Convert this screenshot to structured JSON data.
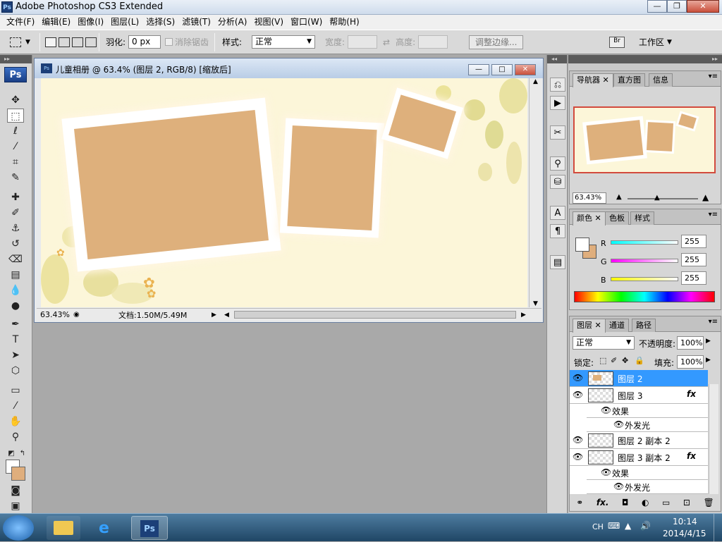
{
  "app": {
    "title": "Adobe Photoshop CS3 Extended"
  },
  "menu": [
    "文件(F)",
    "编辑(E)",
    "图像(I)",
    "图层(L)",
    "选择(S)",
    "滤镜(T)",
    "分析(A)",
    "视图(V)",
    "窗口(W)",
    "帮助(H)"
  ],
  "options": {
    "feather_label": "羽化:",
    "feather_value": "0 px",
    "antialias_label": "消除锯齿",
    "style_label": "样式:",
    "style_value": "正常",
    "width_label": "宽度:",
    "height_label": "高度:",
    "refine_button": "调整边缘...",
    "workspace_label": "工作区"
  },
  "document": {
    "title": "儿童相册 @ 63.4% (图层 2, RGB/8) [缩放后]",
    "zoom": "63.43%",
    "doc_size": "文档:1.50M/5.49M"
  },
  "navigator": {
    "tabs": [
      "导航器",
      "直方图",
      "信息"
    ],
    "zoom": "63.43%"
  },
  "color": {
    "tabs": [
      "颜色",
      "色板",
      "样式"
    ],
    "channels": [
      {
        "label": "R",
        "value": "255"
      },
      {
        "label": "G",
        "value": "255"
      },
      {
        "label": "B",
        "value": "255"
      }
    ],
    "foreground": "#ffffff",
    "background": "#dfae7d"
  },
  "layers": {
    "tabs": [
      "图层",
      "通道",
      "路径"
    ],
    "blend_mode": "正常",
    "opacity_label": "不透明度:",
    "opacity": "100%",
    "lock_label": "锁定:",
    "fill_label": "填充:",
    "fill": "100%",
    "items": [
      {
        "name": "图层 2",
        "selected": true,
        "fx": false
      },
      {
        "name": "图层 3",
        "selected": false,
        "fx": true
      },
      {
        "name": "效果",
        "sub": true
      },
      {
        "name": "外发光",
        "sub2": true
      },
      {
        "name": "图层 2 副本 2",
        "selected": false,
        "fx": false
      },
      {
        "name": "图层 3 副本 2",
        "selected": false,
        "fx": true
      },
      {
        "name": "效果",
        "sub": true
      },
      {
        "name": "外发光",
        "sub2": true
      }
    ],
    "fx_label": "fx"
  },
  "taskbar": {
    "lang": "CH",
    "time": "10:14",
    "date": "2014/4/15"
  },
  "colors": {
    "accent": "#3399ff",
    "photo_fill": "#deb07c",
    "canvas_bg": "#fcf6d9"
  }
}
